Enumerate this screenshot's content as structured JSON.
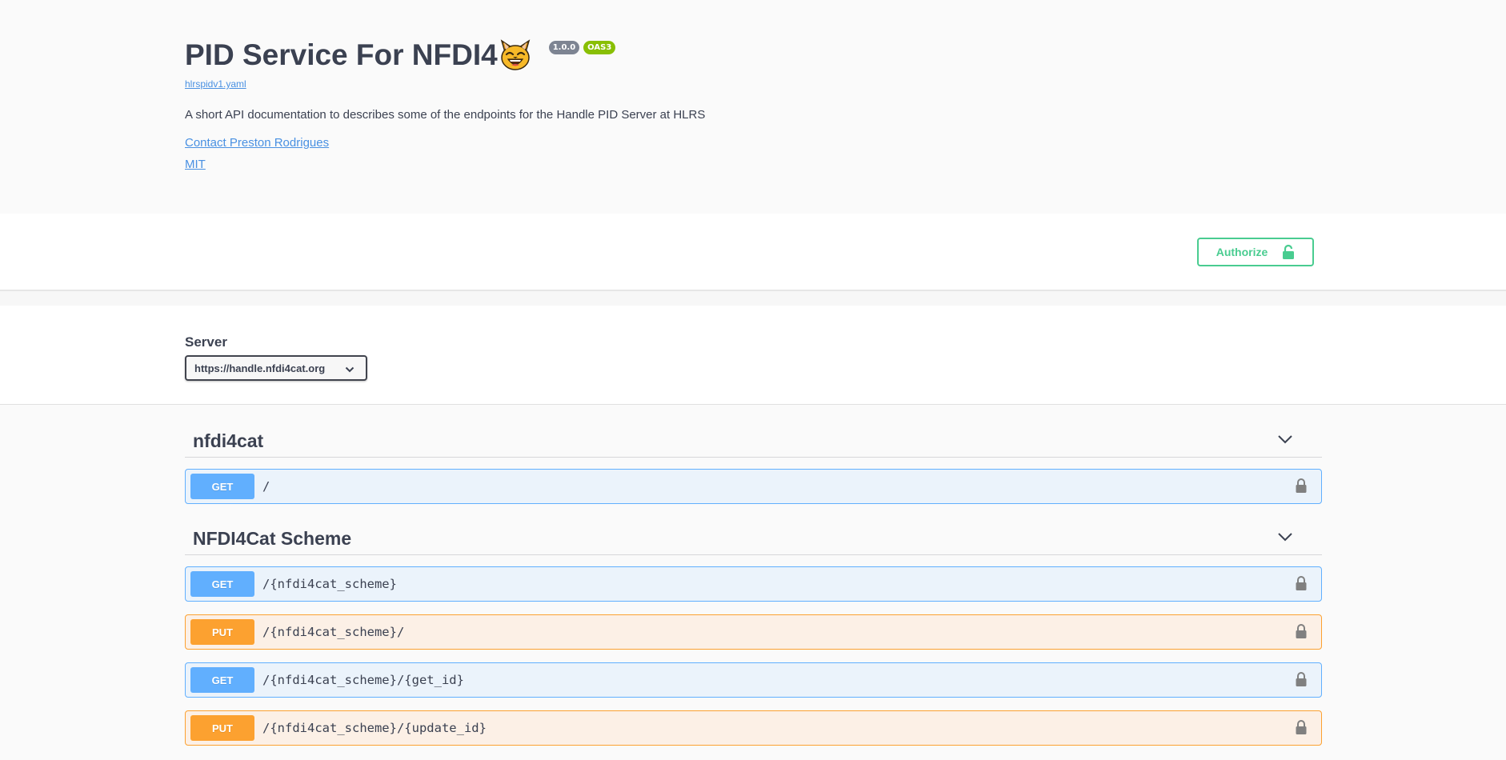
{
  "info": {
    "title": "PID Service For NFDI4",
    "version_badge": "1.0.0",
    "oas_badge": "OAS3",
    "spec_link": "hlrspidv1.yaml",
    "description": "A short API documentation to describes some of the endpoints for the Handle PID Server at HLRS",
    "contact_link": "Contact Preston Rodrigues",
    "license_link": "MIT"
  },
  "auth": {
    "authorize_label": "Authorize"
  },
  "servers": {
    "label": "Server",
    "selected": "https://handle.nfdi4cat.org"
  },
  "tags": [
    {
      "name": "nfdi4cat",
      "operations": [
        {
          "method": "GET",
          "path": "/"
        }
      ]
    },
    {
      "name": "NFDI4Cat Scheme",
      "operations": [
        {
          "method": "GET",
          "path": "/{nfdi4cat_scheme}"
        },
        {
          "method": "PUT",
          "path": "/{nfdi4cat_scheme}/"
        },
        {
          "method": "GET",
          "path": "/{nfdi4cat_scheme}/{get_id}"
        },
        {
          "method": "PUT",
          "path": "/{nfdi4cat_scheme}/{update_id}"
        }
      ]
    }
  ],
  "icons": {
    "title_emoji": "smiling-cat-emoji",
    "authorize_icon": "unlock-icon",
    "operation_lock": "lock-icon",
    "tag_toggle": "chevron-down-icon",
    "server_toggle": "chevron-down-icon"
  },
  "colors": {
    "get": "#61affe",
    "put": "#fca130",
    "authorize": "#49cc90",
    "link": "#4990e2",
    "version_badge": "#7d8492",
    "oas_badge": "#89bf04"
  }
}
